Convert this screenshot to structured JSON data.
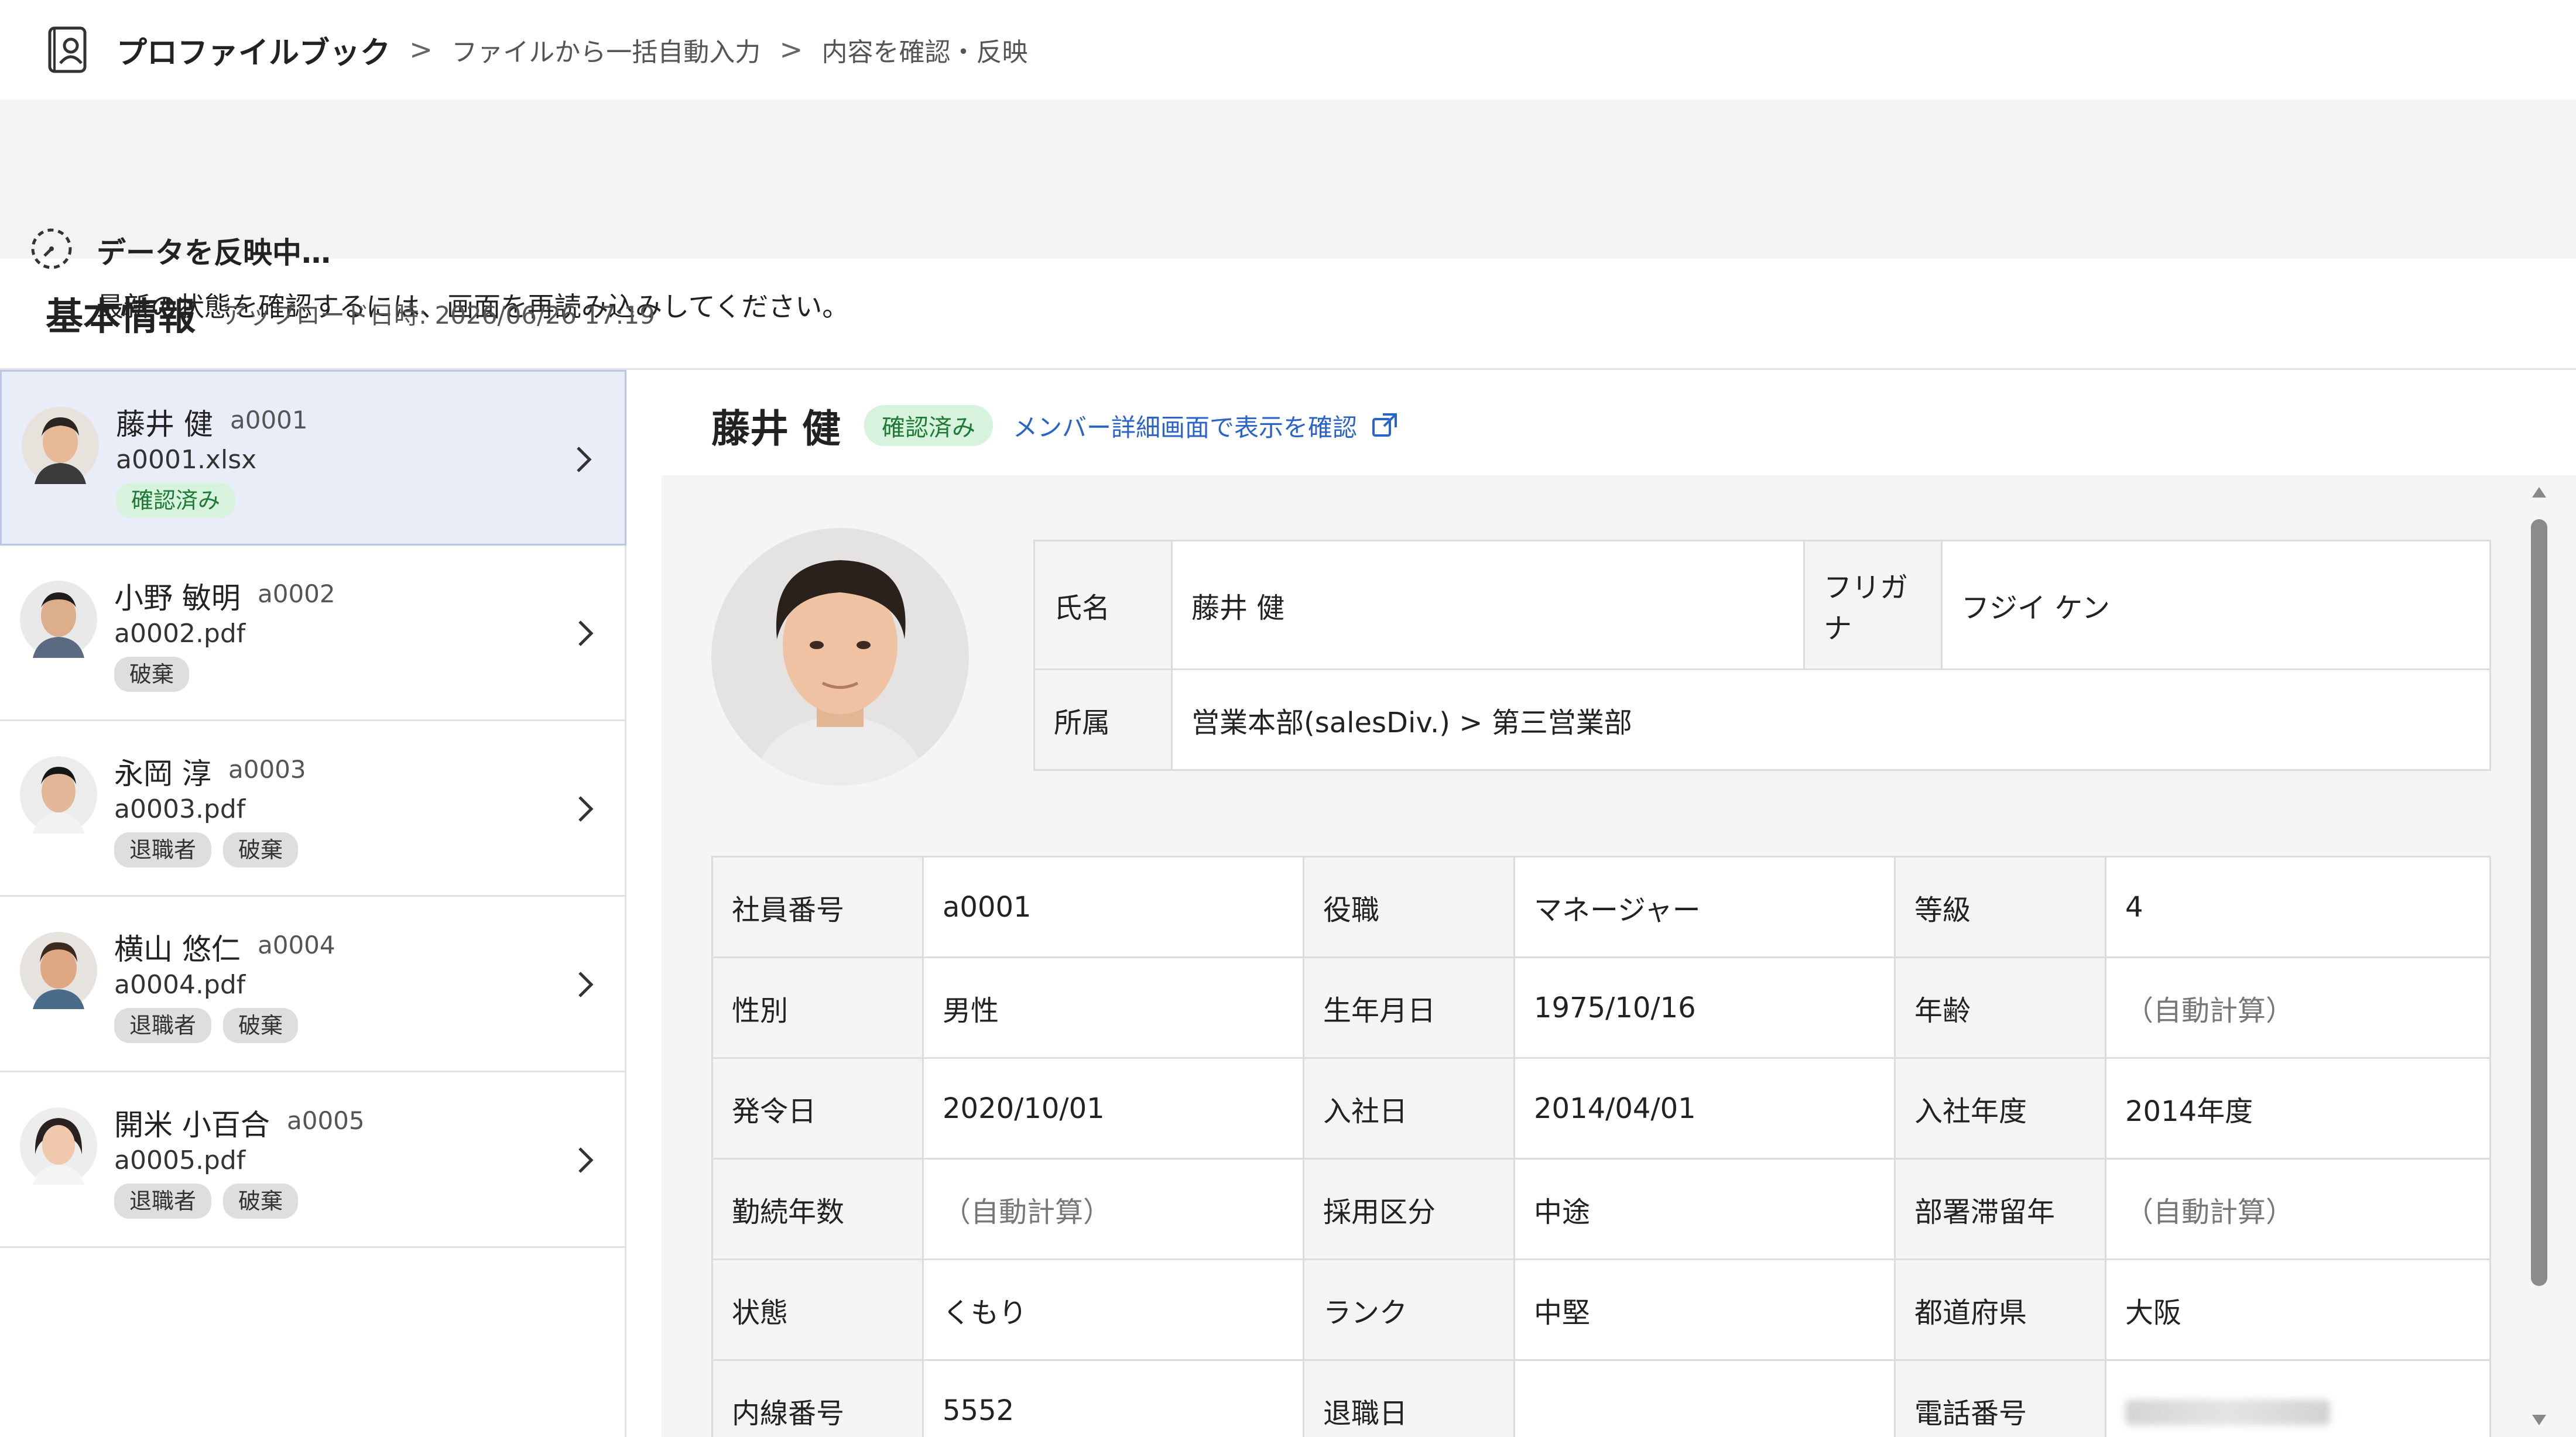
{
  "breadcrumb": {
    "app": "プロファイルブック",
    "sep1": ">",
    "sep2": ">",
    "items": [
      "ファイルから一括自動入力",
      "内容を確認・反映"
    ]
  },
  "notice": {
    "title": "データを反映中…",
    "body": "最新の状態を確認するには、画面を再読み込みしてください。"
  },
  "section": {
    "title": "基本情報",
    "upload_time": "アップロード日時: 2026/06/26 17:19"
  },
  "list": [
    {
      "name": "藤井 健",
      "code": "a0001",
      "file": "a0001.xlsx",
      "badges": [
        "確認済み"
      ],
      "selected": true
    },
    {
      "name": "小野 敏明",
      "code": "a0002",
      "file": "a0002.pdf",
      "badges": [
        "破棄"
      ]
    },
    {
      "name": "永岡 淳",
      "code": "a0003",
      "file": "a0003.pdf",
      "badges": [
        "退職者",
        "破棄"
      ]
    },
    {
      "name": "横山 悠仁",
      "code": "a0004",
      "file": "a0004.pdf",
      "badges": [
        "退職者",
        "破棄"
      ]
    },
    {
      "name": "開米 小百合",
      "code": "a0005",
      "file": "a0005.pdf",
      "badges": [
        "退職者",
        "破棄"
      ]
    }
  ],
  "detail": {
    "name": "藤井 健",
    "status_badge": "確認済み",
    "member_link": "メンバー詳細画面で表示を確認",
    "top_table": {
      "name_label": "氏名",
      "name_value": "藤井 健",
      "kana_label": "フリガナ",
      "kana_value": "フジイ ケン",
      "dept_label": "所属",
      "dept_value": "営業本部(salesDiv.) > 第三営業部"
    },
    "fields": [
      [
        [
          "社員番号",
          "a0001"
        ],
        [
          "役職",
          "マネージャー"
        ],
        [
          "等級",
          "4"
        ]
      ],
      [
        [
          "性別",
          "男性"
        ],
        [
          "生年月日",
          "1975/10/16"
        ],
        [
          "年齢",
          "（自動計算）"
        ]
      ],
      [
        [
          "発令日",
          "2020/10/01"
        ],
        [
          "入社日",
          "2014/04/01"
        ],
        [
          "入社年度",
          "2014年度"
        ]
      ],
      [
        [
          "勤続年数",
          "（自動計算）"
        ],
        [
          "採用区分",
          "中途"
        ],
        [
          "部署滞留年",
          "（自動計算）"
        ]
      ],
      [
        [
          "状態",
          "くもり"
        ],
        [
          "ランク",
          "中堅"
        ],
        [
          "都道府県",
          "大阪"
        ]
      ],
      [
        [
          "内線番号",
          "5552"
        ],
        [
          "退職日",
          ""
        ],
        [
          "電話番号",
          ""
        ]
      ]
    ]
  },
  "colors": {
    "accent_link": "#2a63c9",
    "confirmed_bg": "#d7f2dd",
    "confirmed_text": "#1f7a35",
    "selected_row": "#e8edf8"
  }
}
